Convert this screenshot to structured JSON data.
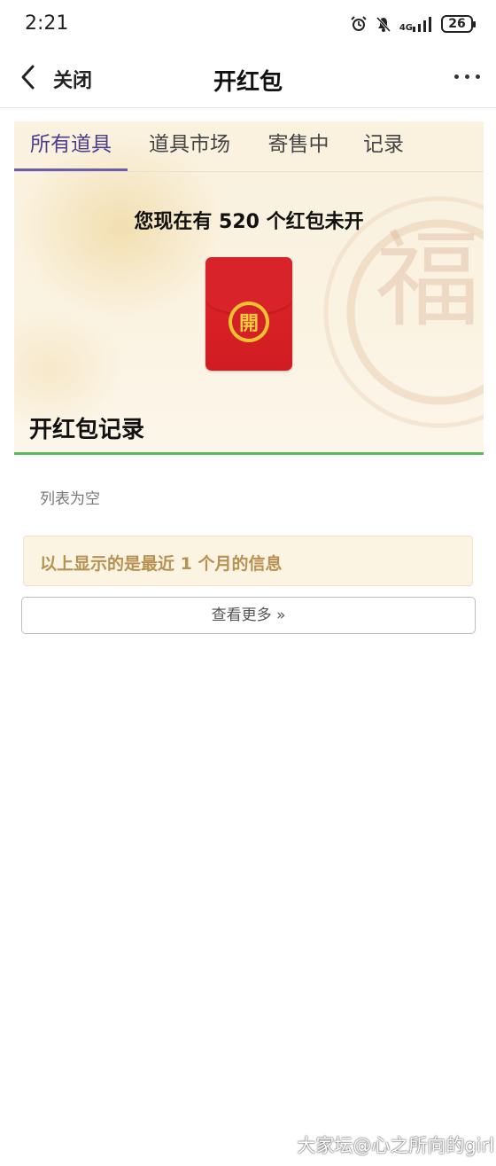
{
  "status_bar": {
    "time": "2:21",
    "network": "4G",
    "battery": "26",
    "icons": [
      "alarm-icon",
      "mute-bell-icon",
      "signal-icon",
      "battery-icon"
    ]
  },
  "navbar": {
    "back_label": "关闭",
    "title": "开红包",
    "icons": [
      "back-chevron-icon",
      "more-dots-icon"
    ]
  },
  "tabs": [
    {
      "label": "所有道具",
      "active": true
    },
    {
      "label": "道具市场",
      "active": false
    },
    {
      "label": "寄售中",
      "active": false
    },
    {
      "label": "记录",
      "active": false
    }
  ],
  "main": {
    "count_text": "您现在有 520 个红包未开",
    "packet_seal": "開",
    "record_title": "开红包记录",
    "empty_text": "列表为空",
    "notice": "以上显示的是最近 1 个月的信息",
    "more_button": "查看更多 »"
  },
  "watermark": "大家坛@心之所向的girl",
  "colors": {
    "tab_active": "#4a3f8c",
    "accent_line": "#5cb85c",
    "packet_red": "#d8232a",
    "seal_gold": "#f2c230",
    "notice_text": "#b79052",
    "notice_bg": "#fcf4e2"
  }
}
